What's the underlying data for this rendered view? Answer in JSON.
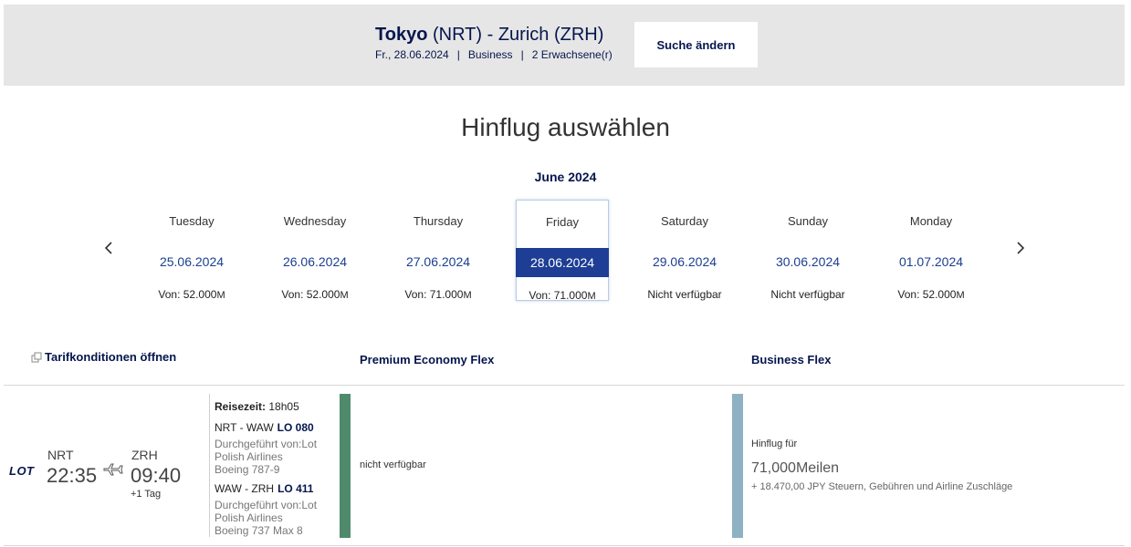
{
  "header": {
    "city_from": "Tokyo",
    "code_from": "(NRT) -",
    "city_to": "Zurich",
    "code_to": "(ZRH)",
    "date": "Fr., 28.06.2024",
    "cabin": "Business",
    "passengers": "2 Erwachsene(r)",
    "separator": "|",
    "change_button": "Suche ändern"
  },
  "page_title": "Hinflug auswählen",
  "calendar": {
    "month": "June 2024",
    "days": [
      {
        "name": "Tuesday",
        "date": "25.06.2024",
        "price": "Von: 52.000",
        "unit": "M"
      },
      {
        "name": "Wednesday",
        "date": "26.06.2024",
        "price": "Von: 52.000",
        "unit": "M"
      },
      {
        "name": "Thursday",
        "date": "27.06.2024",
        "price": "Von: 71.000",
        "unit": "M"
      },
      {
        "name": "Friday",
        "date": "28.06.2024",
        "price": "Von: 71.000",
        "unit": "M"
      },
      {
        "name": "Saturday",
        "date": "29.06.2024",
        "price": "Nicht verfügbar",
        "unit": ""
      },
      {
        "name": "Sunday",
        "date": "30.06.2024",
        "price": "Nicht verfügbar",
        "unit": ""
      },
      {
        "name": "Monday",
        "date": "01.07.2024",
        "price": "Von: 52.000",
        "unit": "M"
      }
    ],
    "selected_index": 3
  },
  "columns": {
    "tarif": "Tarifkonditionen öffnen",
    "premium": "Premium Economy Flex",
    "business": "Business Flex"
  },
  "flight": {
    "airline_logo": "LOT",
    "from_code": "NRT",
    "to_code": "ZRH",
    "depart": "22:35",
    "arrive": "09:40",
    "day_offset": "+1 Tag",
    "travel_label": "Reisezeit:",
    "travel_time": "18h05",
    "leg1": {
      "route": "NRT - WAW",
      "flight": "LO 080",
      "operated": "Durchgeführt von:Lot",
      "operator2": "Polish Airlines",
      "aircraft": "Boeing 787-9"
    },
    "leg2": {
      "route": "WAW - ZRH",
      "flight": "LO 411",
      "operated": "Durchgeführt von:Lot",
      "operator2": "Polish Airlines",
      "aircraft": "Boeing 737 Max 8"
    }
  },
  "fares": {
    "premium_status": "nicht verfügbar",
    "business_label": "Hinflug für",
    "business_miles": "71,000Meilen",
    "business_tax": "+ 18.470,00 JPY Steuern, Gebühren und Airline Zuschläge"
  },
  "colors": {
    "brand": "#05164d",
    "selected_date": "#1e3e95",
    "premium_bar": "#4f8a6b",
    "business_bar": "#8eb1c4"
  },
  "icons": {
    "prev": "chevron-left-icon",
    "next": "chevron-right-icon",
    "plane": "plane-icon",
    "expand": "expand-icon"
  }
}
